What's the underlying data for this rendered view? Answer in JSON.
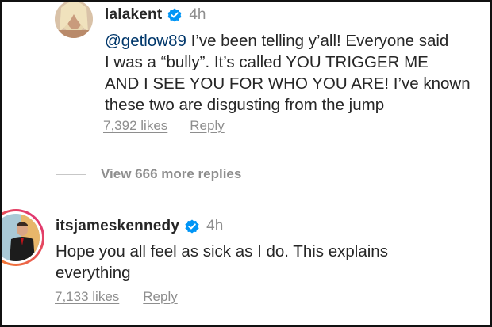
{
  "comments": [
    {
      "username": "lalakent",
      "time": "4h",
      "mention": "@getlow89",
      "text": " I’ve been telling y’all! Everyone said\nI was a “bully”. It’s called YOU TRIGGER ME\nAND I SEE YOU FOR WHO YOU ARE! I’ve known\nthese two are disgusting from the jump",
      "likes": "7,392 likes",
      "reply": "Reply"
    },
    {
      "username": "itsjameskennedy",
      "time": "4h",
      "mention": "",
      "text": "Hope you all feel as sick as I do. This explains\neverything",
      "likes": "7,133 likes",
      "reply": "Reply"
    }
  ],
  "view_more_replies": "View 666 more replies",
  "icons": {
    "verified": "verified-badge-icon"
  },
  "colors": {
    "verified_blue": "#0095f6",
    "story_ring_start": "#f58529",
    "story_ring_end": "#dd2a7b"
  }
}
